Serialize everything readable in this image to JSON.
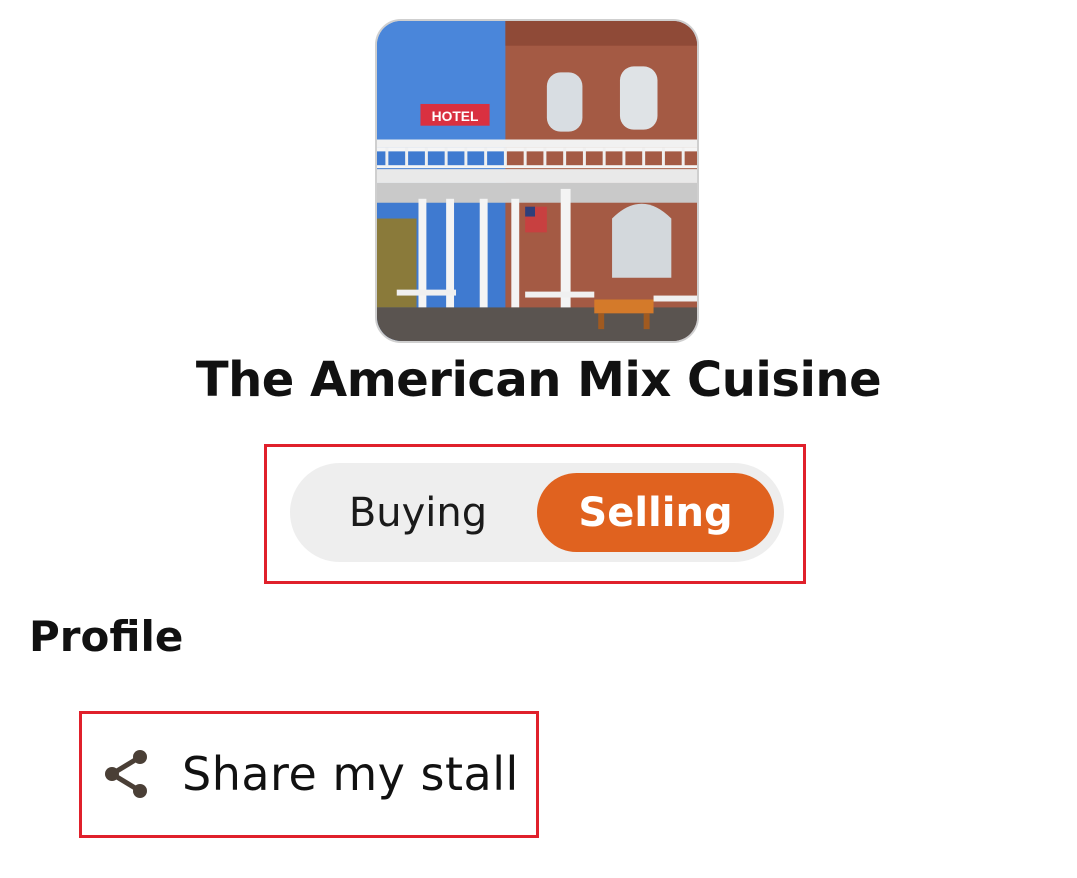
{
  "store": {
    "name": "The American Mix Cuisine",
    "avatar_alt": "hotel-photo",
    "sign_text": "HOTEL"
  },
  "mode_toggle": {
    "options": [
      "Buying",
      "Selling"
    ],
    "selected": "Selling",
    "accent_color": "#e0621f"
  },
  "profile": {
    "section_title": "Profile",
    "items": [
      {
        "label": "Share my stall",
        "icon": "share-icon"
      }
    ]
  },
  "highlight_color": "#e0202b"
}
